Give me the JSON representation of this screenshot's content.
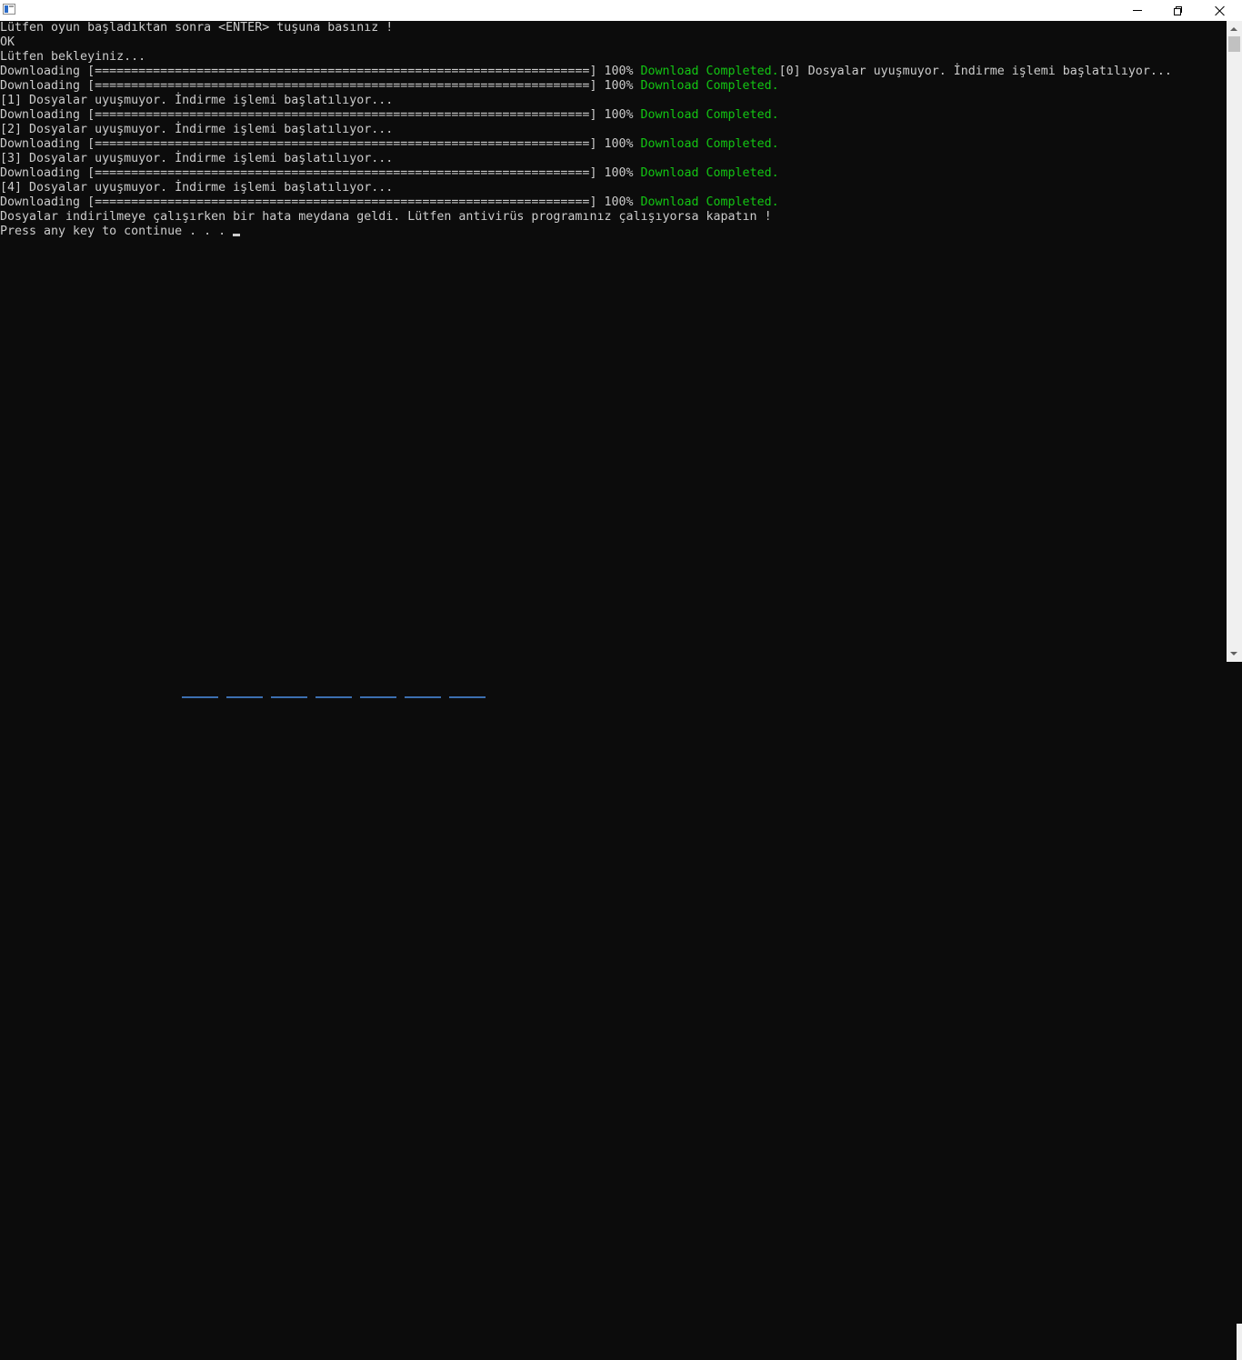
{
  "window": {
    "title": "",
    "controls": {
      "minimize": "minimize",
      "maximize": "restore",
      "close": "close"
    }
  },
  "console": {
    "lines": [
      {
        "text": "Lütfen oyun başladıktan sonra <ENTER> tuşuna basınız !",
        "ok": "",
        "tail": ""
      },
      {
        "text": "OK",
        "ok": "",
        "tail": ""
      },
      {
        "text": "Lütfen bekleyiniz...",
        "ok": "",
        "tail": ""
      },
      {
        "text": "Downloading [====================================================================] 100% ",
        "ok": "Download Completed.",
        "tail": "[0] Dosyalar uyuşmuyor. İndirme işlemi başlatılıyor..."
      },
      {
        "text": "Downloading [====================================================================] 100% ",
        "ok": "Download Completed.",
        "tail": ""
      },
      {
        "text": "[1] Dosyalar uyuşmuyor. İndirme işlemi başlatılıyor...",
        "ok": "",
        "tail": ""
      },
      {
        "text": "Downloading [====================================================================] 100% ",
        "ok": "Download Completed.",
        "tail": ""
      },
      {
        "text": "[2] Dosyalar uyuşmuyor. İndirme işlemi başlatılıyor...",
        "ok": "",
        "tail": ""
      },
      {
        "text": "Downloading [====================================================================] 100% ",
        "ok": "Download Completed.",
        "tail": ""
      },
      {
        "text": "[3] Dosyalar uyuşmuyor. İndirme işlemi başlatılıyor...",
        "ok": "",
        "tail": ""
      },
      {
        "text": "Downloading [====================================================================] 100% ",
        "ok": "Download Completed.",
        "tail": ""
      },
      {
        "text": "[4] Dosyalar uyuşmuyor. İndirme işlemi başlatılıyor...",
        "ok": "",
        "tail": ""
      },
      {
        "text": "Downloading [====================================================================] 100% ",
        "ok": "Download Completed.",
        "tail": ""
      },
      {
        "text": "Dosyalar indirilmeye çalışırken bir hata meydana geldi. Lütfen antivirüs programınız çalışıyorsa kapatın !",
        "ok": "",
        "tail": ""
      },
      {
        "text": "Press any key to continue . . . ",
        "ok": "",
        "tail": ""
      }
    ]
  },
  "colors": {
    "background": "#0c0c0c",
    "text": "#cccccc",
    "success": "#13c613"
  }
}
